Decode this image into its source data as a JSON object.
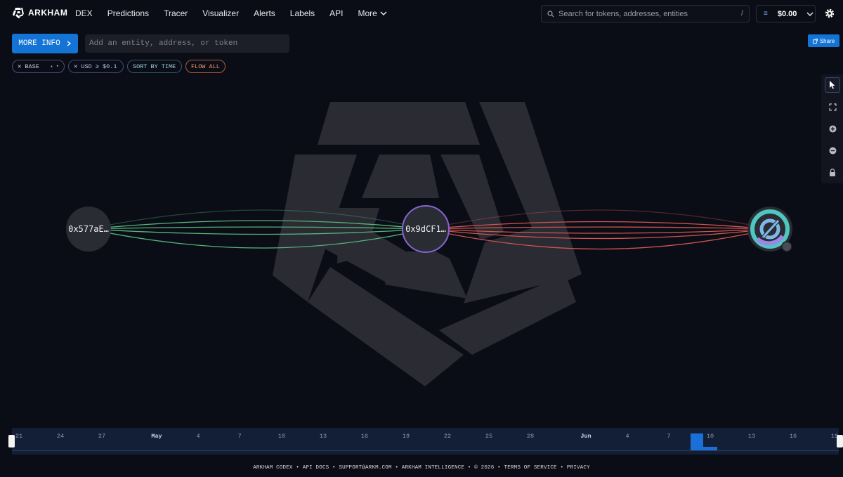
{
  "brand": {
    "name": "ARKHAM"
  },
  "nav": {
    "items": [
      "DEX",
      "Predictions",
      "Tracer",
      "Visualizer",
      "Alerts",
      "Labels",
      "API"
    ],
    "more_label": "More"
  },
  "search": {
    "placeholder": "Search for tokens, addresses, entities",
    "shortcut": "/"
  },
  "wallet": {
    "balance": "$0.00",
    "icon": "wallet-icon"
  },
  "controls": {
    "more_info_label": "MORE INFO",
    "entity_placeholder": "Add an entity, address, or token",
    "share_label": "Share"
  },
  "filters": {
    "chain": "BASE",
    "usd": "USD ≥ $0.1",
    "sort": "SORT BY TIME",
    "flow": "FLOW ALL"
  },
  "toolbar": {
    "tools": [
      "pointer-icon",
      "fit-icon",
      "zoom-in-icon",
      "zoom-out-icon",
      "lock-icon"
    ]
  },
  "graph": {
    "nodes": [
      {
        "label": "0x577aE…"
      },
      {
        "label": "0x9dCF1…"
      },
      {
        "label": "",
        "icon": "usdc-token-icon"
      }
    ],
    "colors": {
      "inflow": "#57b37a",
      "outflow": "#d0554f",
      "node": "#2a2c34",
      "accent": "#8a63d2"
    }
  },
  "timeline": {
    "ticks": [
      {
        "label": "21",
        "month": false
      },
      {
        "label": "24",
        "month": false
      },
      {
        "label": "27",
        "month": false
      },
      {
        "label": "May",
        "month": true
      },
      {
        "label": "4",
        "month": false
      },
      {
        "label": "7",
        "month": false
      },
      {
        "label": "10",
        "month": false
      },
      {
        "label": "13",
        "month": false
      },
      {
        "label": "16",
        "month": false
      },
      {
        "label": "19",
        "month": false
      },
      {
        "label": "22",
        "month": false
      },
      {
        "label": "25",
        "month": false
      },
      {
        "label": "28",
        "month": false
      },
      {
        "label": "Jun",
        "month": true
      },
      {
        "label": "4",
        "month": false
      },
      {
        "label": "7",
        "month": false
      },
      {
        "label": "10",
        "month": false
      },
      {
        "label": "13",
        "month": false
      },
      {
        "label": "16",
        "month": false
      },
      {
        "label": "19",
        "month": false
      }
    ]
  },
  "footer": {
    "items": [
      "ARKHAM CODEX",
      "API DOCS",
      "SUPPORT@ARKM.COM",
      "ARKHAM INTELLIGENCE",
      "© 2026",
      "TERMS OF SERVICE",
      "PRIVACY"
    ],
    "separator": " • "
  }
}
